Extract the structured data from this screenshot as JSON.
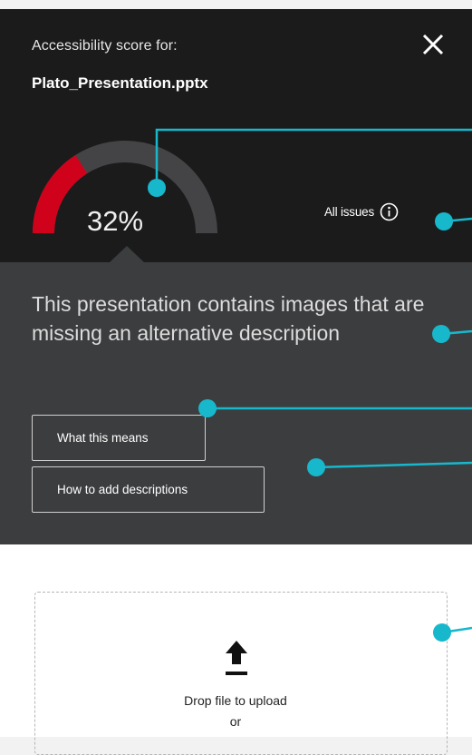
{
  "header": {
    "label": "Accessibility score for:",
    "filename": "Plato_Presentation.pptx",
    "close_icon": "close-icon"
  },
  "score": {
    "value_text": "32%",
    "value": 32,
    "color_fill": "#d0021b",
    "color_track": "#444446"
  },
  "issues": {
    "label": "All issues",
    "icon": "info-icon"
  },
  "message": {
    "text": "This presentation contains images that are missing an alternative description"
  },
  "buttons": {
    "what_means": "What this means",
    "how_to_add": "How to add descriptions"
  },
  "upload": {
    "icon": "upload-icon",
    "drop_text": "Drop file to upload",
    "or_text": "or"
  },
  "colors": {
    "callout": "#17b8cc",
    "panel": "#1b1b1b",
    "message_bg": "#3c3d3f"
  }
}
